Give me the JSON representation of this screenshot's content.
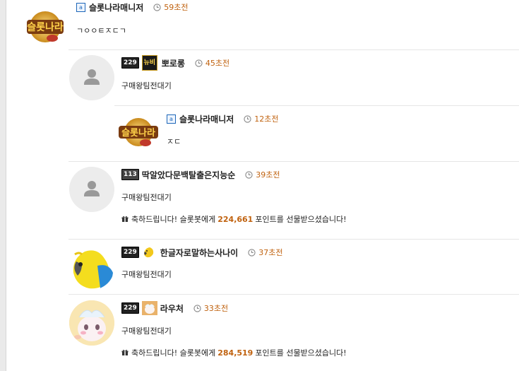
{
  "comments": [
    {
      "nickname": "슬롯나라매니저",
      "time": "59초전",
      "body": "ㄱㅇㅇㅌㅈㄷㄱ",
      "admin_badge": "a",
      "avatar_text": "슬롯나라"
    },
    {
      "nickname": "뽀로롱",
      "time": "45초전",
      "body": "구매왕팀전대기",
      "level": "229",
      "icon_text": "뉴비"
    },
    {
      "nickname": "슬롯나라매니저",
      "time": "12초전",
      "body": "ㅈㄷ",
      "admin_badge": "a",
      "avatar_text": "슬롯나라"
    },
    {
      "nickname": "딱알았다문백탈출은지능순",
      "time": "39초전",
      "body": "구매왕팀전대기",
      "level": "113",
      "gift": {
        "prefix": "축하드립니다! 슬롯봇에게",
        "points": "224,661",
        "suffix": "포인트를 선물받으셨습니다!"
      }
    },
    {
      "nickname": "한글자로말하는사나이",
      "time": "37초전",
      "body": "구매왕팀전대기",
      "level": "229"
    },
    {
      "nickname": "라우처",
      "time": "33초전",
      "body": "구매왕팀전대기",
      "level": "229",
      "gift": {
        "prefix": "축하드립니다! 슬롯봇에게",
        "points": "284,519",
        "suffix": "포인트를 선물받으셨습니다!"
      }
    }
  ],
  "colors": {
    "time": "#c0620f",
    "points": "#c0620f",
    "admin_badge": "#1d66b8",
    "level_badge": "#222222"
  },
  "icons": [
    "clock-icon",
    "gift-icon",
    "default-user-icon"
  ]
}
